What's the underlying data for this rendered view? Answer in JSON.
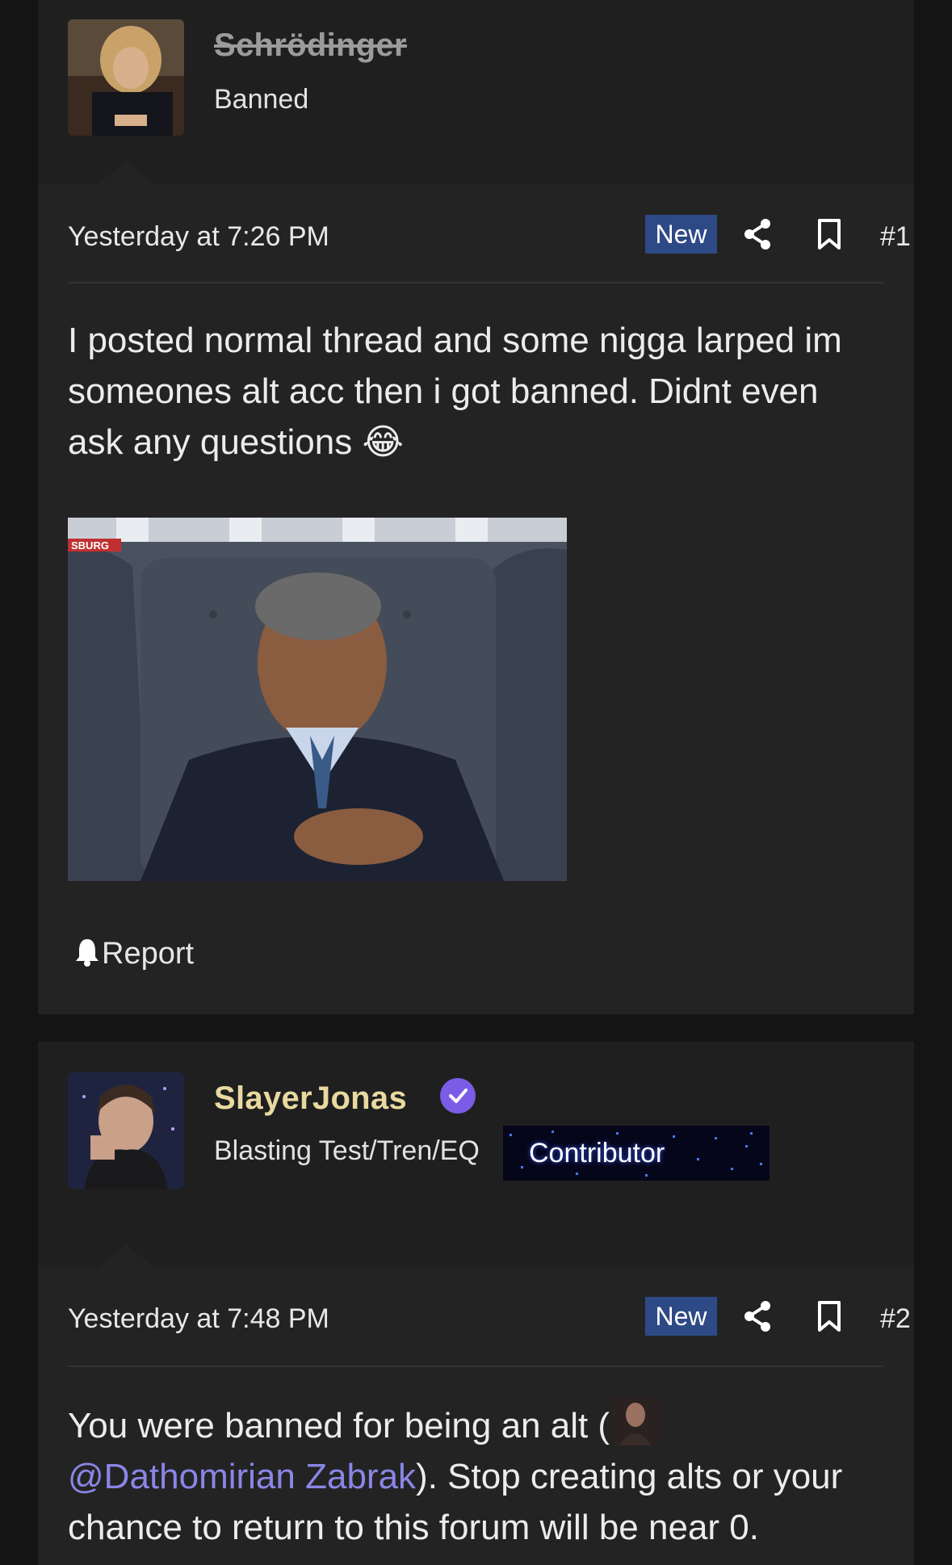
{
  "posts": [
    {
      "username": "Schrödinger",
      "user_title": "Banned",
      "username_color": "#9b9b9b",
      "date": "Yesterday at 7:26 PM",
      "badge": "New",
      "number": "#1",
      "body": "I posted normal thread and some nigga larped im someones alt acc then i got banned. Didnt even ask any questions",
      "emoji": "😂",
      "attachment_caption": "SBURG",
      "report_label": "Report"
    },
    {
      "username": "SlayerJonas",
      "user_title": "Blasting Test/Tren/EQ",
      "user_banner": "Contributor",
      "username_color": "#e8d9a0",
      "date": "Yesterday at 7:48 PM",
      "badge": "New",
      "number": "#2",
      "body_before": "You were banned for being an alt (",
      "mention": "@Dathomirian Zabrak",
      "body_after": "). Stop creating alts or your chance to return to this forum will be near 0."
    }
  ],
  "colors": {
    "background": "#141414",
    "post_bg": "#232323",
    "header_bg": "#1f1f1f",
    "new_badge": "#2e4a86",
    "mention": "#8a86e6",
    "verified": "#7b5ce6"
  }
}
